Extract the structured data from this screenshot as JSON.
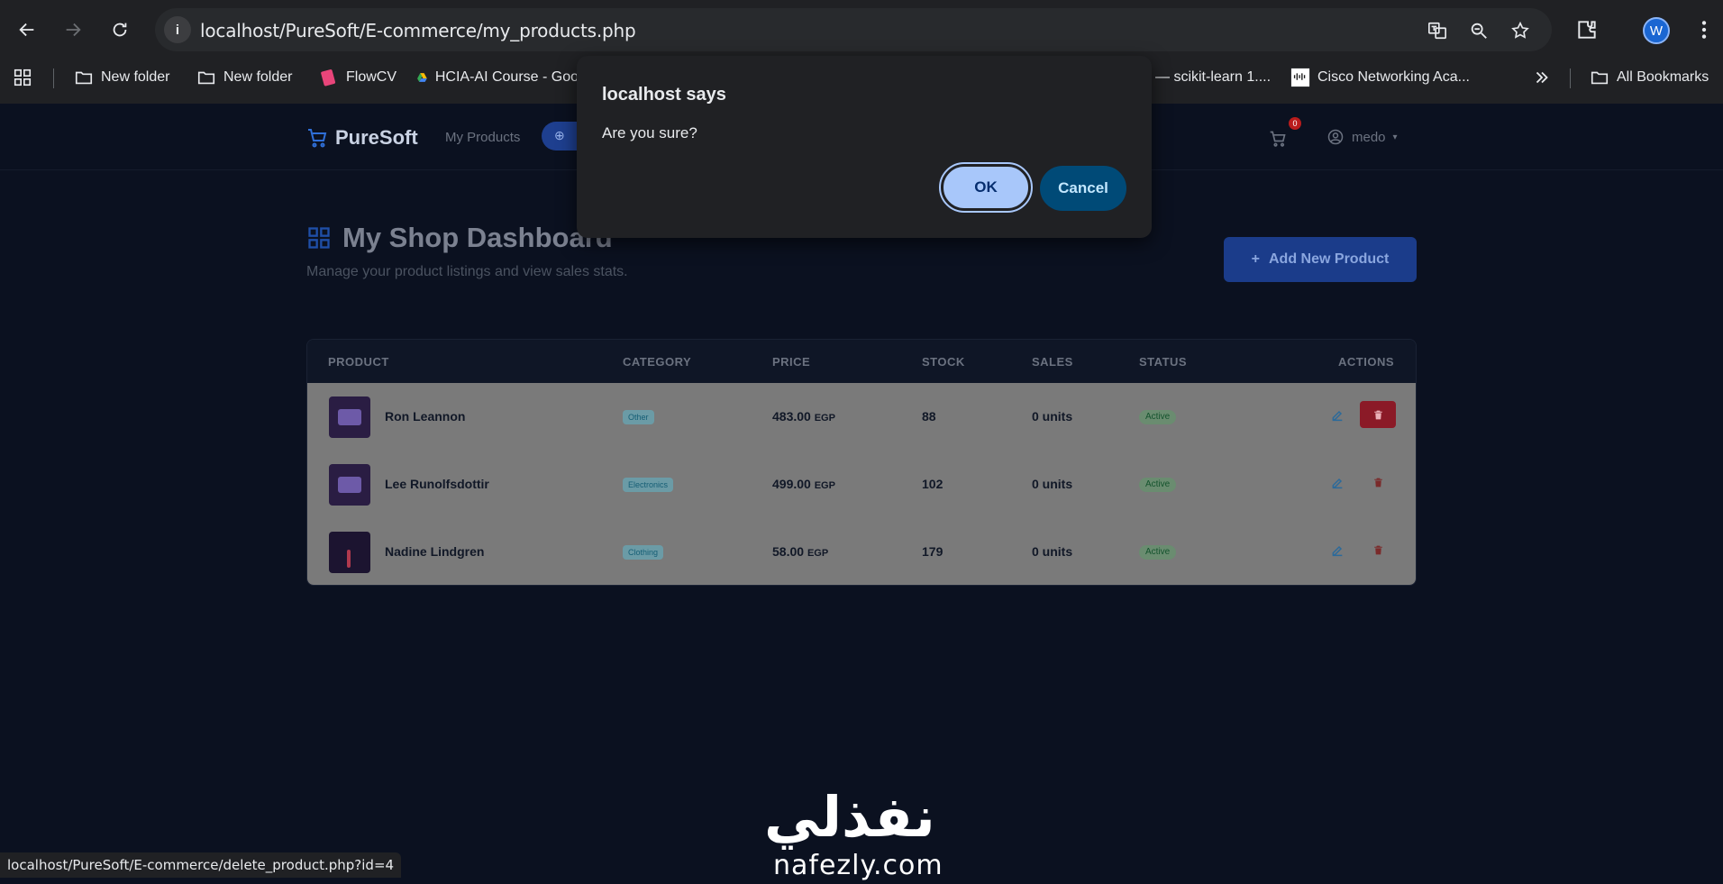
{
  "browser": {
    "url": "localhost/PureSoft/E-commerce/my_products.php",
    "profile_initial": "W",
    "bookmarks": [
      "New folder",
      "New folder",
      "FlowCV",
      "HCIA-AI Course - Goo",
      "— scikit-learn 1....",
      "Cisco Networking Aca..."
    ],
    "all_bookmarks": "All Bookmarks",
    "status_url": "localhost/PureSoft/E-commerce/delete_product.php?id=4"
  },
  "navbar": {
    "brand": "PureSoft",
    "my_products": "My Products",
    "cart_count": "0",
    "username": "medo"
  },
  "dashboard": {
    "title": "My Shop Dashboard",
    "subtitle": "Manage your product listings and view sales stats.",
    "add_button": "Add New Product"
  },
  "table": {
    "headers": [
      "PRODUCT",
      "CATEGORY",
      "PRICE",
      "STOCK",
      "SALES",
      "STATUS",
      "ACTIONS"
    ],
    "rows": [
      {
        "name": "Ron Leannon",
        "category": "Other",
        "price": "483.00",
        "currency": "EGP",
        "stock": "88",
        "sales": "0 units",
        "status": "Active"
      },
      {
        "name": "Lee Runolfsdottir",
        "category": "Electronics",
        "price": "499.00",
        "currency": "EGP",
        "stock": "102",
        "sales": "0 units",
        "status": "Active"
      },
      {
        "name": "Nadine Lindgren",
        "category": "Clothing",
        "price": "58.00",
        "currency": "EGP",
        "stock": "179",
        "sales": "0 units",
        "status": "Active"
      }
    ]
  },
  "dialog": {
    "title": "localhost says",
    "message": "Are you sure?",
    "ok": "OK",
    "cancel": "Cancel"
  },
  "watermark": {
    "arabic": "نفذلي",
    "latin": "nafezly.com"
  },
  "colors": {
    "accent": "#2f6fd8",
    "danger": "#8b1a27",
    "dialog_ok": "#a8c7fa",
    "dialog_cancel": "#004a77"
  }
}
